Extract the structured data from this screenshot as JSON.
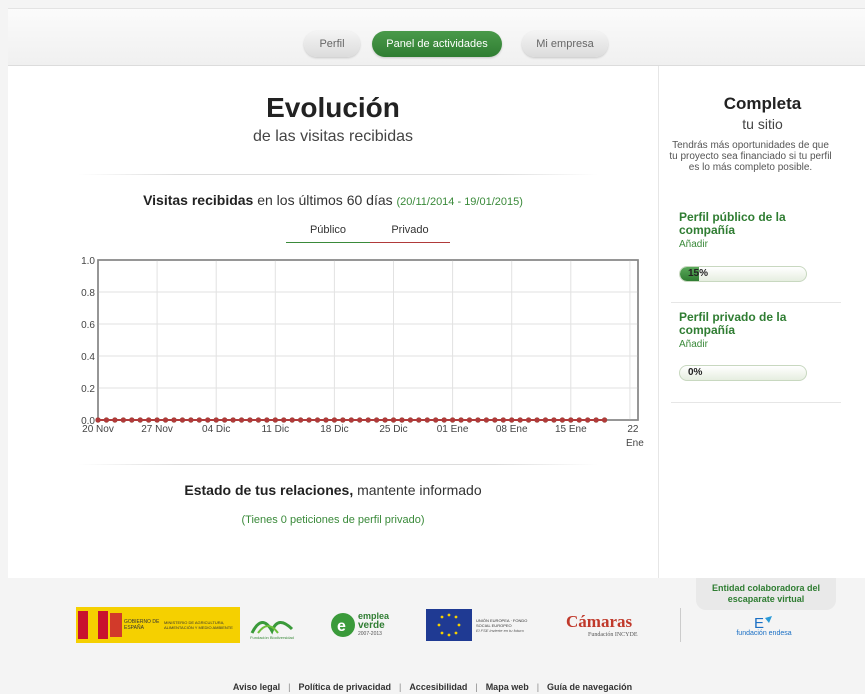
{
  "tabs": [
    {
      "label": "Perfil",
      "active": false
    },
    {
      "label": "Panel de actividades",
      "active": true
    },
    {
      "label": "Mi empresa",
      "active": false
    }
  ],
  "main": {
    "title": "Evolución",
    "subtitle": "de las visitas recibidas",
    "visits_bold": "Visitas recibidas",
    "visits_rest": " en los últimos 60 días ",
    "visits_range": "(20/11/2014 - 19/01/2015)",
    "legend_public": "Público",
    "legend_private": "Privado",
    "relations_bold": "Estado de tus relaciones,",
    "relations_rest": " mantente informado",
    "requests": "(Tienes 0 peticiones de perfil privado)"
  },
  "chart_data": {
    "type": "line",
    "x_tick_labels": [
      "20 Nov",
      "27 Nov",
      "04 Dic",
      "11 Dic",
      "18 Dic",
      "25 Dic",
      "01 Ene",
      "08 Ene",
      "15 Ene",
      "22 Ene"
    ],
    "y_tick_labels": [
      "0.0",
      "0.2",
      "0.4",
      "0.6",
      "0.8",
      "1.0"
    ],
    "ylim": [
      0,
      1
    ],
    "x_range": [
      "20 Nov",
      "22 Ene"
    ],
    "series": [
      {
        "name": "Público",
        "color": "#3a8a3a",
        "values": [
          0,
          0,
          0,
          0,
          0,
          0,
          0,
          0,
          0,
          0,
          0,
          0,
          0,
          0,
          0,
          0,
          0,
          0,
          0,
          0,
          0,
          0,
          0,
          0,
          0,
          0,
          0,
          0,
          0,
          0,
          0,
          0,
          0,
          0,
          0,
          0,
          0,
          0,
          0,
          0,
          0,
          0,
          0,
          0,
          0,
          0,
          0,
          0,
          0,
          0,
          0,
          0,
          0,
          0,
          0,
          0,
          0,
          0,
          0,
          0,
          0
        ]
      },
      {
        "name": "Privado",
        "color": "#b03a3a",
        "values": [
          0,
          0,
          0,
          0,
          0,
          0,
          0,
          0,
          0,
          0,
          0,
          0,
          0,
          0,
          0,
          0,
          0,
          0,
          0,
          0,
          0,
          0,
          0,
          0,
          0,
          0,
          0,
          0,
          0,
          0,
          0,
          0,
          0,
          0,
          0,
          0,
          0,
          0,
          0,
          0,
          0,
          0,
          0,
          0,
          0,
          0,
          0,
          0,
          0,
          0,
          0,
          0,
          0,
          0,
          0,
          0,
          0,
          0,
          0,
          0,
          0
        ]
      }
    ],
    "grid": true
  },
  "sidebar": {
    "title": "Completa",
    "subtitle": "tu sitio",
    "description": "Tendrás más oportunidades de que tu proyecto sea financiado si tu perfil es lo más completo posible.",
    "public_title": "Perfil público de la compañía",
    "public_add": "Añadir",
    "public_progress": 0.15,
    "public_progress_label": "15%",
    "private_title": "Perfil privado de la compañía",
    "private_add": "Añadir",
    "private_progress": 0,
    "private_progress_label": "0%"
  },
  "footer": {
    "collab": "Entidad colaboradora del escaparate virtual",
    "gob_text1": "GOBIERNO DE ESPAÑA",
    "gob_text2": "MINISTERIO DE AGRICULTURA, ALIMENTACIÓN Y MEDIO AMBIENTE",
    "fb_text": "Fundación Biodiversidad",
    "emplea_text1": "emplea",
    "emplea_text2": "verde",
    "emplea_years": "2007-2013",
    "ue_text": "UNIÓN EUROPEA · FONDO SOCIAL EUROPEO",
    "ue_sub": "El FSE invierte en tu futuro",
    "camaras_text": "Cámaras",
    "camaras_sub": "Fundación INCYDE",
    "endesa_text": "fundación endesa",
    "links": [
      "Aviso legal",
      "Política de privacidad",
      "Accesibilidad",
      "Mapa web",
      "Guía de navegación"
    ]
  },
  "colors": {
    "brand_green": "#2f7d32",
    "private_red": "#b03a3a"
  }
}
